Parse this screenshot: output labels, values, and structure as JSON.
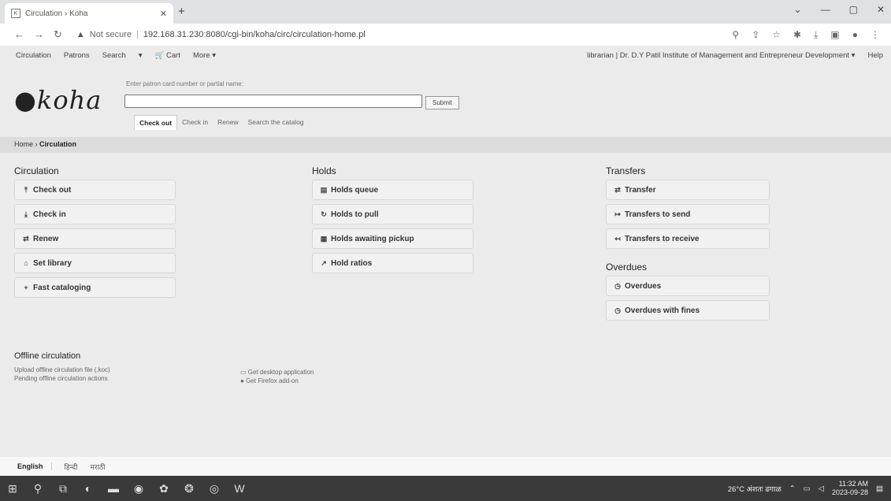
{
  "browser": {
    "tab_title": "Circulation › Koha",
    "not_secure": "Not secure",
    "url": "192.168.31.230:8080/cgi-bin/koha/circ/circulation-home.pl"
  },
  "topnav": {
    "items": [
      "Circulation",
      "Patrons",
      "Search",
      "▾",
      "🛒 Cart",
      "More ▾"
    ],
    "user": "librarian",
    "library": "Dr. D.Y Patil Institute of Management and Entrepreneur Development ▾",
    "help": "Help"
  },
  "logo": "koha",
  "search": {
    "hint": "Enter patron card number or partial name:",
    "submit": "Submit",
    "tabs": [
      "Check out",
      "Check in",
      "Renew",
      "Search the catalog"
    ]
  },
  "breadcrumb": {
    "home": "Home",
    "current": "Circulation"
  },
  "circulation": {
    "title": "Circulation",
    "items": [
      "Check out",
      "Check in",
      "Renew",
      "Set library",
      "Fast cataloging"
    ]
  },
  "holds": {
    "title": "Holds",
    "items": [
      "Holds queue",
      "Holds to pull",
      "Holds awaiting pickup",
      "Hold ratios"
    ]
  },
  "transfers": {
    "title": "Transfers",
    "items": [
      "Transfer",
      "Transfers to send",
      "Transfers to receive"
    ]
  },
  "overdues": {
    "title": "Overdues",
    "items": [
      "Overdues",
      "Overdues with fines"
    ]
  },
  "offline": {
    "title": "Offline circulation",
    "upload": "Upload offline circulation file (.koc)",
    "pending": "Pending offline circulation actions",
    "desktop": "Get desktop application",
    "firefox": "Get Firefox add-on"
  },
  "footer": {
    "langs": [
      "English",
      "हिन्दी",
      "मराठी"
    ]
  },
  "taskbar": {
    "weather": "26°C अंशतः ढगाळ",
    "time": "11:32 AM",
    "date": "2023-09-28"
  }
}
